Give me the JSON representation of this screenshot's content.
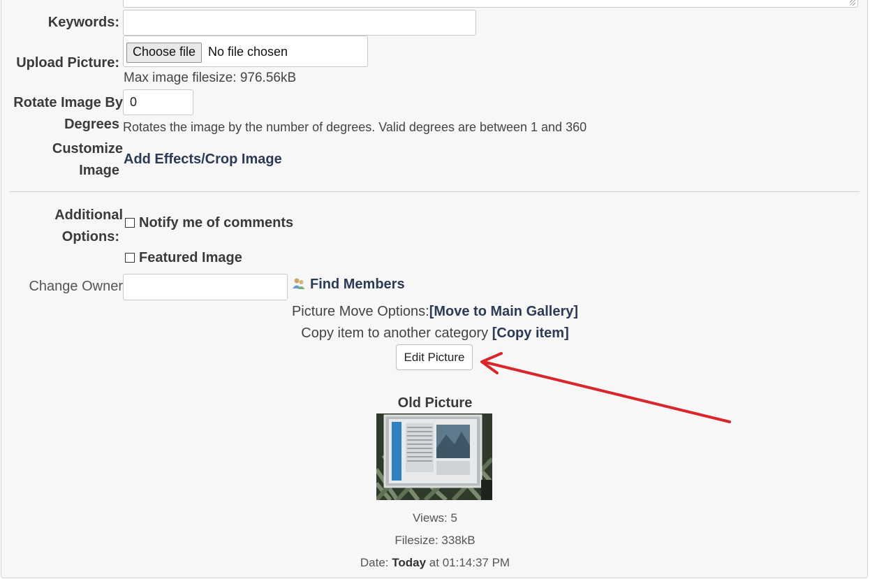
{
  "form": {
    "keywords": {
      "label": "Keywords:",
      "value": ""
    },
    "upload": {
      "label": "Upload Picture:",
      "button_label": "Choose file",
      "status_text": "No file chosen",
      "max_size_text": "Max image filesize: 976.56kB"
    },
    "rotate": {
      "label_line1": "Rotate Image By",
      "label_line2": "Degrees",
      "value": "0",
      "help_text": "Rotates the image by the number of degrees. Valid degrees are between 1 and 360"
    },
    "customize": {
      "label_line1": "Customize",
      "label_line2": "Image",
      "link_text": "Add Effects/Crop Image"
    },
    "additional": {
      "label_line1": "Additional",
      "label_line2": "Options:",
      "notify_label": "Notify me of comments",
      "featured_label": "Featured Image"
    },
    "owner": {
      "label": "Change Owner",
      "value": "",
      "find_members_label": "Find Members"
    },
    "move": {
      "prefix": "Picture Move Options:",
      "link_text": "[Move to Main Gallery]"
    },
    "copy": {
      "prefix": "Copy item to another category",
      "link_text": "[Copy item]"
    },
    "edit_button_label": "Edit Picture"
  },
  "old_picture": {
    "heading": "Old Picture",
    "views_text": "Views: 5",
    "filesize_text": "Filesize: 338kB",
    "date_prefix": "Date:",
    "date_bold": "Today",
    "date_suffix": "at 01:14:37 PM"
  },
  "colors": {
    "link": "#2b3a55",
    "annotation_arrow": "#d9262b",
    "panel_bg": "#f7f7f7"
  }
}
